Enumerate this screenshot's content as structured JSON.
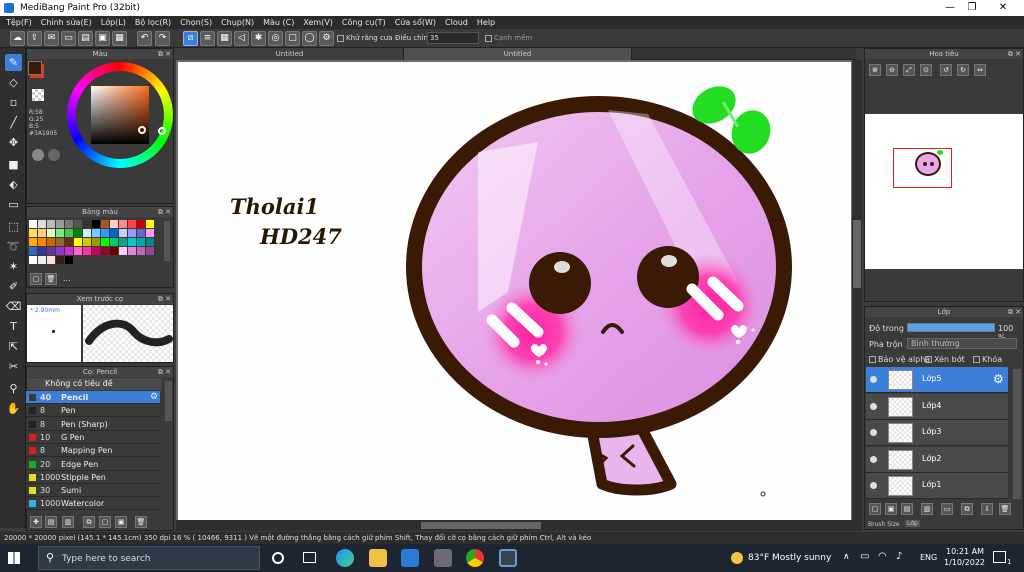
{
  "window": {
    "title": "MediBang Paint Pro (32bit)",
    "minimize": "—",
    "maximize": "❐",
    "close": "✕"
  },
  "menu": [
    "Tệp(F)",
    "Chỉnh sửa(E)",
    "Lớp(L)",
    "Bộ lọc(R)",
    "Chọn(S)",
    "Chụp(N)",
    "Màu (C)",
    "Xem(V)",
    "Công cụ(T)",
    "Cửa sổ(W)",
    "Cloud",
    "Help"
  ],
  "toolbar": {
    "antialias_label": "Khử răng cưa",
    "adjust_label": "Điều chỉnh",
    "adjust_value": "35",
    "smooth_label": "Cạnh mềm"
  },
  "tabs": [
    "Untitled",
    "Untitled"
  ],
  "color_panel": {
    "title": "Màu",
    "rgb": [
      "R:58",
      "G:25",
      "B:5"
    ],
    "hex": "#3A1905",
    "primary_color": "#3a1905",
    "secondary_color": "#e23a1a"
  },
  "palette_panel": {
    "title": "Bảng màu",
    "more": "..."
  },
  "preview_panel": {
    "title": "Xem trước cọ",
    "size": "2.90mm"
  },
  "brush_panel": {
    "title": "Cọ: Pencil",
    "group": "Không có tiêu đề",
    "items": [
      {
        "size": "40",
        "name": "Pencil",
        "color": "#3a3a3a",
        "selected": true
      },
      {
        "size": "8",
        "name": "Pen",
        "color": "#222222"
      },
      {
        "size": "8",
        "name": "Pen (Sharp)",
        "color": "#222222"
      },
      {
        "size": "10",
        "name": "G Pen",
        "color": "#d62020"
      },
      {
        "size": "8",
        "name": "Mapping Pen",
        "color": "#d62020"
      },
      {
        "size": "20",
        "name": "Edge Pen",
        "color": "#22a822"
      },
      {
        "size": "1000",
        "name": "Stipple Pen",
        "color": "#e8d820"
      },
      {
        "size": "30",
        "name": "Sumi",
        "color": "#e8d820"
      },
      {
        "size": "1000",
        "name": "Watercolor",
        "color": "#3ab0e8"
      }
    ]
  },
  "navigator": {
    "title": "Hoa tiêu"
  },
  "layer_panel": {
    "title": "Lớp",
    "opacity_label": "Độ trong",
    "opacity_value": "100 %",
    "opacity_fraction": 1.0,
    "blend_label": "Pha trộn",
    "blend_value": "Bình thường",
    "protect_alpha": "Bảo vệ alpha",
    "clip": "Xén bớt",
    "lock": "Khóa",
    "layers": [
      {
        "name": "Lớp5",
        "selected": true
      },
      {
        "name": "Lớp4"
      },
      {
        "name": "Lớp3"
      },
      {
        "name": "Lớp2"
      },
      {
        "name": "Lớp1"
      }
    ],
    "bottom_tabs": [
      "Brush Size",
      "Lớp"
    ]
  },
  "canvas_text": {
    "line1": "Tholai1",
    "line2": "HD247"
  },
  "status": "20000 * 20000 pixel   (145.1 * 145.1cm)   350 dpi   16 %   ( 10466, 9311 )   Vẽ một đường thẳng bằng cách giữ phím Shift, Thay đổi cỡ cọ bằng cách giữ phím Ctrl, Alt và kéo",
  "taskbar": {
    "search_placeholder": "Type here to search",
    "weather": "83°F  Mostly sunny",
    "lang": "ENG",
    "time": "10:21 AM",
    "date": "1/10/2022",
    "notif_count": "1"
  },
  "colors": {
    "accent": "#3b7fd8",
    "ink": "#3a1905",
    "cheek": "#ff2aa8",
    "face": "#e9a8ec",
    "leaf": "#22dd22"
  }
}
